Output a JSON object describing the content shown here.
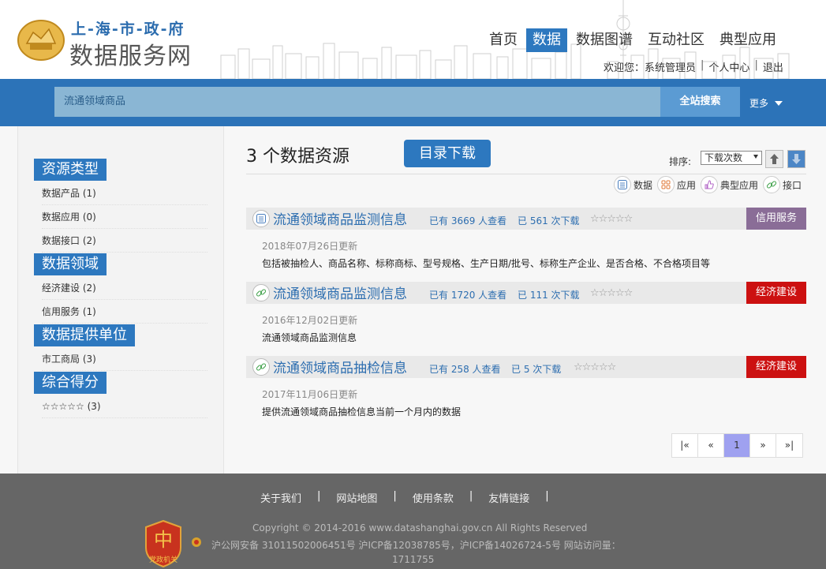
{
  "header": {
    "logo_line1": "上-海-市-政-府",
    "logo_line2": "数据服务网",
    "nav": [
      {
        "label": "首页",
        "active": false
      },
      {
        "label": "数据",
        "active": true
      },
      {
        "label": "数据图谱",
        "active": false
      },
      {
        "label": "互动社区",
        "active": false
      },
      {
        "label": "典型应用",
        "active": false
      }
    ],
    "welcome": "欢迎您：",
    "username": "系统管理员",
    "personal_center": "个人中心",
    "logout": "退出"
  },
  "search": {
    "value": "流通领域商品",
    "button_label": "全站搜索",
    "more_label": "更多"
  },
  "sidebar": {
    "facets": [
      {
        "title": "资源类型",
        "items": [
          "数据产品 (1)",
          "数据应用 (0)",
          "数据接口 (2)"
        ]
      },
      {
        "title": "数据领域",
        "items": [
          "经济建设 (2)",
          "信用服务 (1)"
        ]
      },
      {
        "title": "数据提供单位",
        "items": [
          "市工商局 (3)"
        ]
      },
      {
        "title": "综合得分",
        "items": [
          "☆☆☆☆☆ (3)"
        ]
      }
    ]
  },
  "main": {
    "result_count": "3 个数据资源",
    "download_catalog": "目录下载",
    "sort_label": "排序:",
    "sort_value": "下载次数",
    "legend": [
      {
        "label": "数据",
        "icon": "list-icon"
      },
      {
        "label": "应用",
        "icon": "grid-icon"
      },
      {
        "label": "典型应用",
        "icon": "thumb-icon"
      },
      {
        "label": "接口",
        "icon": "link-icon"
      }
    ],
    "items": [
      {
        "icon": "list-icon",
        "title": "流通领域商品监测信息",
        "views": "已有 3669 人查看",
        "downloads": "已 561 次下载",
        "stars": "☆☆☆☆☆",
        "badge": "信用服务",
        "badge_color": "#8a6d97",
        "date": "2018年07月26日更新",
        "desc": "包括被抽检人、商品名称、标称商标、型号规格、生产日期/批号、标称生产企业、是否合格、不合格项目等"
      },
      {
        "icon": "link-icon",
        "title": "流通领域商品监测信息",
        "views": "已有 1720 人查看",
        "downloads": "已 111 次下载",
        "stars": "☆☆☆☆☆",
        "badge": "经济建设",
        "badge_color": "#cc1111",
        "date": "2016年12月02日更新",
        "desc": "流通领域商品监测信息"
      },
      {
        "icon": "link-icon",
        "title": "流通领域商品抽检信息",
        "views": "已有 258 人查看",
        "downloads": "已 5 次下载",
        "stars": "☆☆☆☆☆",
        "badge": "经济建设",
        "badge_color": "#cc1111",
        "date": "2017年11月06日更新",
        "desc": "提供流通领域商品抽检信息当前一个月内的数据"
      }
    ],
    "pager": [
      "|«",
      "«",
      "1",
      "»",
      "»|"
    ],
    "current_page": "1"
  },
  "footer": {
    "links": [
      "关于我们",
      "网站地图",
      "使用条款",
      "友情链接"
    ],
    "copyright": "Copyright © 2014-2016 www.datashanghai.gov.cn All Rights Reserved",
    "record": "沪公网安备 31011502006451号   沪ICP备12038785号，沪ICP备14026724-5号    网站访问量：",
    "visits": "1711755",
    "badge_text": "党政机关"
  },
  "colors": {
    "primary_blue": "#2d78bf",
    "search_band": "#2c73b8",
    "footer_bg": "#666666"
  }
}
